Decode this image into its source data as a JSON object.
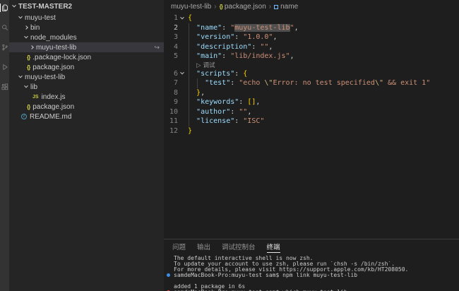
{
  "colors": {
    "activity_bar_bg": "#333333",
    "sidebar_bg": "#252526",
    "editor_bg": "#1e1e1e",
    "selection_row_bg": "#37373d",
    "json_key": "#9cdcfe",
    "json_string": "#ce9178",
    "bracket_gold": "#ffd700",
    "file_icon_yellow": "#cbcb41",
    "info_icon_blue": "#519aba",
    "terminal_dot_blue": "#3b8eea",
    "terminal_dot_red": "#f14c4c"
  },
  "activity_bar": {
    "items": [
      {
        "id": "explorer",
        "icon": "files-icon",
        "active": true
      },
      {
        "id": "search",
        "icon": "search-icon",
        "active": false
      },
      {
        "id": "source-control",
        "icon": "branch-icon",
        "active": false
      },
      {
        "id": "run-debug",
        "icon": "play-icon",
        "active": false
      },
      {
        "id": "extensions",
        "icon": "extensions-icon",
        "active": false
      }
    ]
  },
  "sidebar": {
    "section_header": "TEST-MASTER2",
    "tree": [
      {
        "label": "muyu-test",
        "kind": "folder",
        "expanded": true,
        "level": 0
      },
      {
        "label": "bin",
        "kind": "folder",
        "expanded": false,
        "level": 1
      },
      {
        "label": "node_modules",
        "kind": "folder",
        "expanded": true,
        "level": 1
      },
      {
        "label": "muyu-test-lib",
        "kind": "folder",
        "expanded": false,
        "level": 2,
        "selected": true,
        "decoration": "↪"
      },
      {
        "label": ".package-lock.json",
        "kind": "json-file",
        "level": 1
      },
      {
        "label": "package.json",
        "kind": "json-file",
        "level": 1
      },
      {
        "label": "muyu-test-lib",
        "kind": "folder",
        "expanded": true,
        "level": 0
      },
      {
        "label": "lib",
        "kind": "folder",
        "expanded": true,
        "level": 1
      },
      {
        "label": "index.js",
        "kind": "js-file",
        "level": 2
      },
      {
        "label": "package.json",
        "kind": "json-file",
        "level": 1
      },
      {
        "label": "README.md",
        "kind": "readme-file",
        "level": 0
      }
    ]
  },
  "editor": {
    "breadcrumb": [
      {
        "label": "muyu-test-lib"
      },
      {
        "label": "package.json",
        "icon": "json"
      },
      {
        "label": "name",
        "icon": "symbol"
      }
    ],
    "code_lens": {
      "icon": "▷",
      "label": "调试"
    },
    "rows": [
      {
        "num": 1,
        "fold": true,
        "tokens": [
          {
            "t": "{",
            "c": "brace"
          }
        ]
      },
      {
        "num": 2,
        "active": true,
        "tokens": [
          {
            "t": "  ",
            "c": "pun"
          },
          {
            "t": "\"name\"",
            "c": "key"
          },
          {
            "t": ": ",
            "c": "pun"
          },
          {
            "t": "\"",
            "c": "str"
          },
          {
            "t": "muyu-test-lib",
            "c": "str",
            "sel": true
          },
          {
            "t": "\"",
            "c": "str"
          },
          {
            "t": ",",
            "c": "pun"
          }
        ]
      },
      {
        "num": 3,
        "tokens": [
          {
            "t": "  ",
            "c": "pun"
          },
          {
            "t": "\"version\"",
            "c": "key"
          },
          {
            "t": ": ",
            "c": "pun"
          },
          {
            "t": "\"1.0.0\"",
            "c": "str"
          },
          {
            "t": ",",
            "c": "pun"
          }
        ]
      },
      {
        "num": 4,
        "tokens": [
          {
            "t": "  ",
            "c": "pun"
          },
          {
            "t": "\"description\"",
            "c": "key"
          },
          {
            "t": ": ",
            "c": "pun"
          },
          {
            "t": "\"\"",
            "c": "str"
          },
          {
            "t": ",",
            "c": "pun"
          }
        ]
      },
      {
        "num": 5,
        "tokens": [
          {
            "t": "  ",
            "c": "pun"
          },
          {
            "t": "\"main\"",
            "c": "key"
          },
          {
            "t": ": ",
            "c": "pun"
          },
          {
            "t": "\"lib/index.js\"",
            "c": "str"
          },
          {
            "t": ",",
            "c": "pun"
          }
        ]
      },
      {
        "lens": true
      },
      {
        "num": 6,
        "fold": true,
        "tokens": [
          {
            "t": "  ",
            "c": "pun"
          },
          {
            "t": "\"scripts\"",
            "c": "key"
          },
          {
            "t": ": ",
            "c": "pun"
          },
          {
            "t": "{",
            "c": "brace"
          }
        ]
      },
      {
        "num": 7,
        "tokens": [
          {
            "t": "    ",
            "c": "pun"
          },
          {
            "t": "\"test\"",
            "c": "key"
          },
          {
            "t": ": ",
            "c": "pun"
          },
          {
            "t": "\"echo ",
            "c": "str"
          },
          {
            "t": "\\\"",
            "c": "esc"
          },
          {
            "t": "Error: no test specified",
            "c": "str"
          },
          {
            "t": "\\\"",
            "c": "esc"
          },
          {
            "t": " && exit 1\"",
            "c": "str"
          }
        ]
      },
      {
        "num": 8,
        "tokens": [
          {
            "t": "  ",
            "c": "pun"
          },
          {
            "t": "}",
            "c": "brace"
          },
          {
            "t": ",",
            "c": "pun"
          }
        ]
      },
      {
        "num": 9,
        "tokens": [
          {
            "t": "  ",
            "c": "pun"
          },
          {
            "t": "\"keywords\"",
            "c": "key"
          },
          {
            "t": ": ",
            "c": "pun"
          },
          {
            "t": "[]",
            "c": "brace"
          },
          {
            "t": ",",
            "c": "pun"
          }
        ]
      },
      {
        "num": 10,
        "tokens": [
          {
            "t": "  ",
            "c": "pun"
          },
          {
            "t": "\"author\"",
            "c": "key"
          },
          {
            "t": ": ",
            "c": "pun"
          },
          {
            "t": "\"\"",
            "c": "str"
          },
          {
            "t": ",",
            "c": "pun"
          }
        ]
      },
      {
        "num": 11,
        "tokens": [
          {
            "t": "  ",
            "c": "pun"
          },
          {
            "t": "\"license\"",
            "c": "key"
          },
          {
            "t": ": ",
            "c": "pun"
          },
          {
            "t": "\"ISC\"",
            "c": "str"
          }
        ]
      },
      {
        "num": 12,
        "tokens": [
          {
            "t": "}",
            "c": "brace"
          }
        ]
      }
    ]
  },
  "panel": {
    "tabs": [
      {
        "id": "problems",
        "label": "问题",
        "active": false
      },
      {
        "id": "output",
        "label": "输出",
        "active": false
      },
      {
        "id": "debug-console",
        "label": "调试控制台",
        "active": false
      },
      {
        "id": "terminal",
        "label": "终端",
        "active": true
      }
    ],
    "terminal": {
      "lines": [
        {
          "text": "The default interactive shell is now zsh."
        },
        {
          "text": "To update your account to use zsh, please run `chsh -s /bin/zsh`."
        },
        {
          "text": "For more details, please visit https://support.apple.com/kb/HT208050."
        },
        {
          "dot": "blue",
          "text": "samdeMacBook-Pro:muyu-test sam$ npm link muyu-test-lib"
        },
        {
          "text": ""
        },
        {
          "text": "added 1 package in 6s"
        },
        {
          "dot": "red",
          "text": "samdeMacBook-Pro:muyu-test sam$ which muyu-test-lib"
        }
      ]
    }
  }
}
